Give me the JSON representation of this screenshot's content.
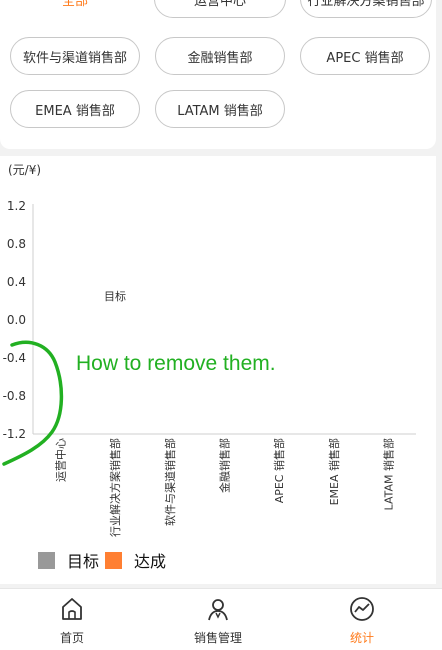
{
  "filters": {
    "chips": [
      {
        "label": "全部",
        "active": true
      },
      {
        "label": "运营中心",
        "active": false
      },
      {
        "label": "行业解决方案销售部",
        "active": false
      },
      {
        "label": "软件与渠道销售部",
        "active": false
      },
      {
        "label": "金融销售部",
        "active": false
      },
      {
        "label": "APEC 销售部",
        "active": false
      },
      {
        "label": "EMEA 销售部",
        "active": false
      },
      {
        "label": "LATAM 销售部",
        "active": false
      }
    ]
  },
  "chart_data": {
    "type": "bar",
    "unit_label": "(元/¥)",
    "categories": [
      "运营中心",
      "行业解决方案销售部",
      "软件与渠道销售部",
      "金融销售部",
      "APEC 销售部",
      "EMEA 销售部",
      "LATAM 销售部"
    ],
    "y_ticks": [
      "1.2",
      "0.8",
      "0.4",
      "0.0",
      "-0.4",
      "-0.8",
      "-1.2"
    ],
    "ylim": [
      -1.2,
      1.2
    ],
    "series": [
      {
        "name": "目标",
        "color": "#999999",
        "values": [
          0,
          0,
          0,
          0,
          0,
          0,
          0
        ]
      },
      {
        "name": "达成",
        "color": "#ff7f32",
        "values": [
          0,
          0,
          0,
          0,
          0,
          0,
          0
        ]
      }
    ],
    "floating_label": "目标",
    "legend": [
      {
        "label": "目标",
        "color": "#999999"
      },
      {
        "label": "达成",
        "color": "#ff7f32"
      }
    ],
    "legend_position": "bottom-left"
  },
  "annotation": {
    "text": "How to remove them.",
    "color": "#22b022"
  },
  "nav": {
    "items": [
      {
        "label": "首页",
        "icon": "home-icon",
        "active": false
      },
      {
        "label": "销售管理",
        "icon": "user-icon",
        "active": false
      },
      {
        "label": "统计",
        "icon": "stats-icon",
        "active": true
      }
    ],
    "active_color": "#ff7a1a"
  }
}
